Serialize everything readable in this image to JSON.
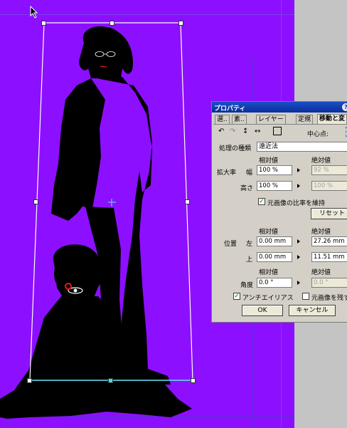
{
  "canvas": {
    "background": "#8d0fff",
    "silhouette_color": "#000000",
    "handle_accent": "#4fd6e6"
  },
  "props": {
    "title": "プロパティ",
    "help_glyph": "?",
    "tabs": [
      "選..",
      "素..",
      "レイヤー",
      "定規",
      "移動と変"
    ],
    "center_label": "中心点:",
    "processing_type_label": "処理の種類",
    "processing_type_value": "遠近法",
    "relative_label": "相対値",
    "absolute_label": "絶対値",
    "scale_label": "拡大率",
    "width_label": "幅",
    "height_label": "高さ",
    "scale_w_rel": "100 %",
    "scale_w_abs": "92 %",
    "scale_h_rel": "100 %",
    "scale_h_abs": "100 %",
    "keep_ratio_label": "元画像の比率を維持",
    "reset_label": "リセット",
    "position_label": "位置",
    "left_label": "左",
    "top_label": "上",
    "pos_left_rel": "0.00 mm",
    "pos_left_abs": "27.26 mm",
    "pos_top_rel": "0.00 mm",
    "pos_top_abs": "11.51 mm",
    "angle_label": "角度",
    "angle_rel": "0.0 °",
    "angle_abs": "0.0 °",
    "antialias_label": "アンチエイリアス",
    "keep_original_label": "元画像を残す",
    "ok_label": "OK",
    "cancel_label": "キャンセル",
    "check_glyph": "✓"
  }
}
